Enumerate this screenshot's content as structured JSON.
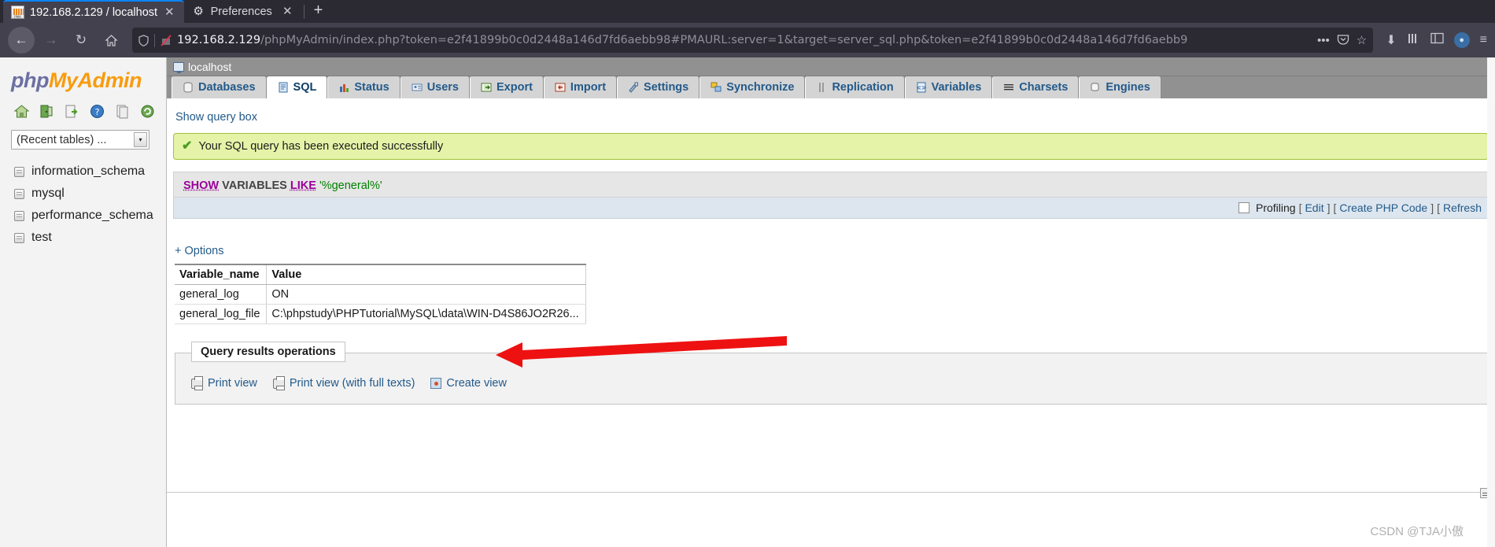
{
  "browser": {
    "tabs": [
      {
        "label": "192.168.2.129 / localhost",
        "icon": "pma-favicon",
        "active": true,
        "close": "✕"
      },
      {
        "label": "Preferences",
        "icon": "gear-icon",
        "active": false,
        "close": "✕"
      }
    ],
    "new_tab_label": "+",
    "nav": {
      "back": "←",
      "forward": "→",
      "reload": "↻",
      "home": "⌂"
    },
    "url": {
      "host": "192.168.2.129",
      "path": "/phpMyAdmin/index.php?token=e2f41899b0c0d2448a146d7fd6aebb98#PMAURL:server=1&target=server_sql.php&token=e2f41899b0c0d2448a146d7fd6aebb9",
      "full": "192.168.2.129/phpMyAdmin/index.php?token=e2f41899b0c0d2448a146d7fd6aebb98#PMAURL:server=1&target=server_sql.php&token=e2f41899b0c0d2448a146d7fd6aebb9",
      "overflow": "•••"
    },
    "url_icons": {
      "shield": "⛉",
      "pocket": "Ⓟ",
      "star": "☆"
    },
    "right_icons": {
      "download": "⬇",
      "library": "☰",
      "sidebar": "◫",
      "sync": "◔",
      "menu": "≡"
    }
  },
  "sidebar": {
    "logo": {
      "php": "php",
      "my": "My",
      "admin": "Admin"
    },
    "icons": [
      "home-icon",
      "logout-icon",
      "export-icon",
      "help-icon",
      "docs-icon",
      "refresh-icon"
    ],
    "recent_tables": {
      "value": "(Recent tables) ...",
      "arrow": "▾"
    },
    "databases": [
      {
        "name": "information_schema"
      },
      {
        "name": "mysql"
      },
      {
        "name": "performance_schema"
      },
      {
        "name": "test"
      }
    ]
  },
  "main": {
    "server_label": "localhost",
    "tabs": [
      {
        "label": "Databases",
        "icon": "databases-icon",
        "active": false
      },
      {
        "label": "SQL",
        "icon": "sql-icon",
        "active": true
      },
      {
        "label": "Status",
        "icon": "status-icon",
        "active": false
      },
      {
        "label": "Users",
        "icon": "users-icon",
        "active": false
      },
      {
        "label": "Export",
        "icon": "export-icon",
        "active": false
      },
      {
        "label": "Import",
        "icon": "import-icon",
        "active": false
      },
      {
        "label": "Settings",
        "icon": "settings-icon",
        "active": false
      },
      {
        "label": "Synchronize",
        "icon": "synchronize-icon",
        "active": false
      },
      {
        "label": "Replication",
        "icon": "replication-icon",
        "active": false
      },
      {
        "label": "Variables",
        "icon": "variables-icon",
        "active": false
      },
      {
        "label": "Charsets",
        "icon": "charsets-icon",
        "active": false
      },
      {
        "label": "Engines",
        "icon": "engines-icon",
        "active": false
      }
    ],
    "show_query_box": "Show query box",
    "success_message": "Your SQL query has been executed successfully",
    "success_check": "✔",
    "sql": {
      "kw_show": "SHOW",
      "kw_variables": "VARIABLES",
      "kw_like": "LIKE",
      "literal": "'%general%'"
    },
    "profiling": {
      "label": "Profiling",
      "open_bracket": "[",
      "close_bracket": "]",
      "edit": "Edit",
      "create_php": "Create PHP Code",
      "refresh": "Refresh"
    },
    "options_link": "+ Options",
    "results_table": {
      "headers": [
        "Variable_name",
        "Value"
      ],
      "rows": [
        [
          "general_log",
          "ON"
        ],
        [
          "general_log_file",
          "C:\\phpstudy\\PHPTutorial\\MySQL\\data\\WIN-D4S86JO2R26..."
        ]
      ]
    },
    "operations": {
      "legend": "Query results operations",
      "links": [
        {
          "label": "Print view",
          "icon": "printer-icon"
        },
        {
          "label": "Print view (with full texts)",
          "icon": "printer-icon"
        },
        {
          "label": "Create view",
          "icon": "create-view-icon"
        }
      ]
    }
  },
  "watermark": "CSDN @TJA小傲",
  "colors": {
    "accent_link": "#235a8a",
    "success_bg": "#e5f3a8",
    "sql_keyword": "#990099",
    "sql_string": "#008000",
    "arrow_red": "#ee1111",
    "pma_orange": "#f89c0e",
    "pma_blue": "#6c6fa3"
  }
}
